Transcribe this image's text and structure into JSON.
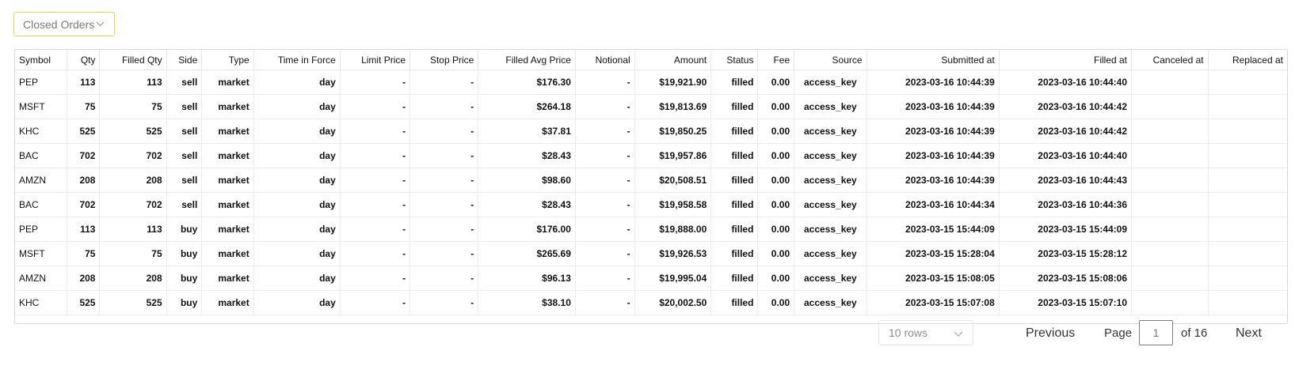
{
  "dropdown": {
    "label": "Closed Orders"
  },
  "table": {
    "columns": [
      "Symbol",
      "Qty",
      "Filled Qty",
      "Side",
      "Type",
      "Time in Force",
      "Limit Price",
      "Stop Price",
      "Filled Avg Price",
      "Notional",
      "Amount",
      "Status",
      "Fee",
      "Source",
      "Submitted at",
      "Filled at",
      "Canceled at",
      "Replaced at"
    ],
    "rows": [
      [
        "PEP",
        "113",
        "113",
        "sell",
        "market",
        "day",
        "-",
        "-",
        "$176.30",
        "-",
        "$19,921.90",
        "filled",
        "0.00",
        "access_key",
        "2023-03-16 10:44:39",
        "2023-03-16 10:44:40",
        "",
        ""
      ],
      [
        "MSFT",
        "75",
        "75",
        "sell",
        "market",
        "day",
        "-",
        "-",
        "$264.18",
        "-",
        "$19,813.69",
        "filled",
        "0.00",
        "access_key",
        "2023-03-16 10:44:39",
        "2023-03-16 10:44:42",
        "",
        ""
      ],
      [
        "KHC",
        "525",
        "525",
        "sell",
        "market",
        "day",
        "-",
        "-",
        "$37.81",
        "-",
        "$19,850.25",
        "filled",
        "0.00",
        "access_key",
        "2023-03-16 10:44:39",
        "2023-03-16 10:44:42",
        "",
        ""
      ],
      [
        "BAC",
        "702",
        "702",
        "sell",
        "market",
        "day",
        "-",
        "-",
        "$28.43",
        "-",
        "$19,957.86",
        "filled",
        "0.00",
        "access_key",
        "2023-03-16 10:44:39",
        "2023-03-16 10:44:40",
        "",
        ""
      ],
      [
        "AMZN",
        "208",
        "208",
        "sell",
        "market",
        "day",
        "-",
        "-",
        "$98.60",
        "-",
        "$20,508.51",
        "filled",
        "0.00",
        "access_key",
        "2023-03-16 10:44:39",
        "2023-03-16 10:44:43",
        "",
        ""
      ],
      [
        "BAC",
        "702",
        "702",
        "sell",
        "market",
        "day",
        "-",
        "-",
        "$28.43",
        "-",
        "$19,958.58",
        "filled",
        "0.00",
        "access_key",
        "2023-03-16 10:44:34",
        "2023-03-16 10:44:36",
        "",
        ""
      ],
      [
        "PEP",
        "113",
        "113",
        "buy",
        "market",
        "day",
        "-",
        "-",
        "$176.00",
        "-",
        "$19,888.00",
        "filled",
        "0.00",
        "access_key",
        "2023-03-15 15:44:09",
        "2023-03-15 15:44:09",
        "",
        ""
      ],
      [
        "MSFT",
        "75",
        "75",
        "buy",
        "market",
        "day",
        "-",
        "-",
        "$265.69",
        "-",
        "$19,926.53",
        "filled",
        "0.00",
        "access_key",
        "2023-03-15 15:28:04",
        "2023-03-15 15:28:12",
        "",
        ""
      ],
      [
        "AMZN",
        "208",
        "208",
        "buy",
        "market",
        "day",
        "-",
        "-",
        "$96.13",
        "-",
        "$19,995.04",
        "filled",
        "0.00",
        "access_key",
        "2023-03-15 15:08:05",
        "2023-03-15 15:08:06",
        "",
        ""
      ],
      [
        "KHC",
        "525",
        "525",
        "buy",
        "market",
        "day",
        "-",
        "-",
        "$38.10",
        "-",
        "$20,002.50",
        "filled",
        "0.00",
        "access_key",
        "2023-03-15 15:07:08",
        "2023-03-15 15:07:10",
        "",
        ""
      ]
    ]
  },
  "pagination": {
    "rows_per_page": "10 rows",
    "previous": "Previous",
    "page_label": "Page",
    "page_value": "1",
    "of_label": "of 16",
    "next": "Next"
  },
  "icons": {
    "dropdown_chevron": "chevron-down-icon",
    "rows_chevron": "chevron-down-icon"
  }
}
